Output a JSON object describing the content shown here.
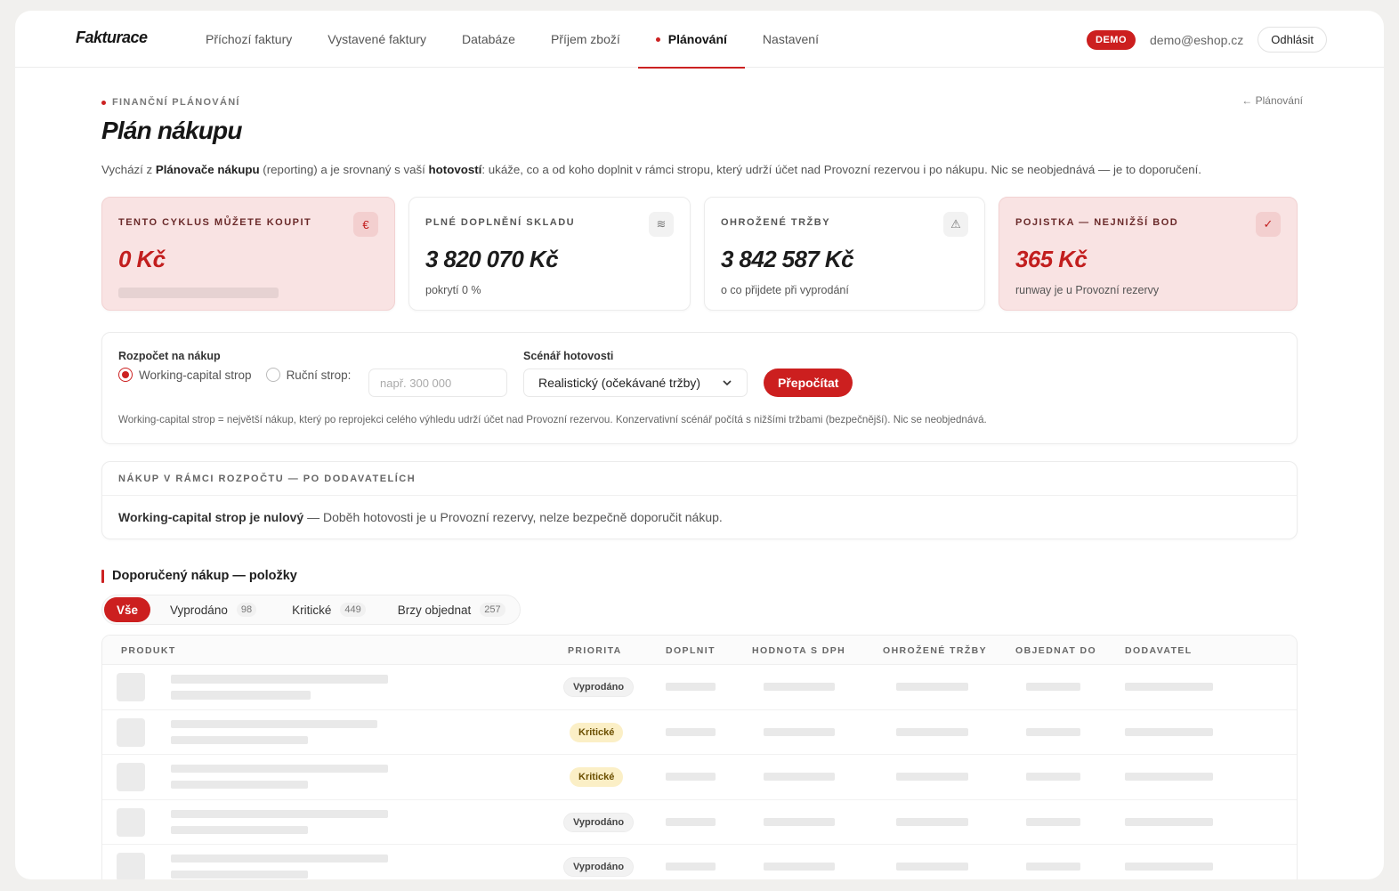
{
  "nav": {
    "brand": "Fakturace",
    "links": [
      "Příchozí faktury",
      "Vystavené faktury",
      "Databáze",
      "Příjem zboží",
      "Plánování",
      "Nastavení"
    ],
    "active_index": 4,
    "demo_badge": "DEMO",
    "email": "demo@eshop.cz",
    "logout": "Odhlásit"
  },
  "header": {
    "eyebrow": "FINANČNÍ PLÁNOVÁNÍ",
    "back_link": "← Plánování",
    "title": "Plán nákupu",
    "intro": {
      "p1": "Vychází z ",
      "b1": "Plánovače nákupu",
      "p2": " (reporting) a je srovnaný s vaší ",
      "b2": "hotovostí",
      "p3": ": ukáže, co a od koho doplnit v rámci stropu, který udrží účet nad Provozní rezervou i po nákupu. Nic se neobjednává — je to doporučení."
    }
  },
  "kpis": [
    {
      "label": "TENTO CYKLUS MŮŽETE KOUPIT",
      "value": "0 Kč",
      "sub": "",
      "icon": "€",
      "icon_name": "euro-icon"
    },
    {
      "label": "PLNÉ DOPLNĚNÍ SKLADU",
      "value": "3 820 070 Kč",
      "sub": "pokrytí 0 %",
      "icon": "≋",
      "icon_name": "layers-icon"
    },
    {
      "label": "OHROŽENÉ TRŽBY",
      "value": "3 842 587 Kč",
      "sub": "o co přijdete při vyprodání",
      "icon": "⚠",
      "icon_name": "warning-icon"
    },
    {
      "label": "POJISTKA — NEJNIŽŠÍ BOD",
      "value": "365 Kč",
      "sub": "runway je u Provozní rezervy",
      "icon": "✓",
      "icon_name": "check-icon"
    }
  ],
  "budget": {
    "label": "Rozpočet na nákup",
    "option_auto": "Working-capital strop",
    "option_manual": "Ruční strop:",
    "manual_placeholder": "např. 300 000",
    "scenario_label": "Scénář hotovosti",
    "scenario_value": "Realistický (očekávané tržby)",
    "recalc_button": "Přepočítat",
    "help": "Working-capital strop = největší nákup, který po reprojekci celého výhledu udrží účet nad Provozní rezervou. Konzervativní scénář počítá s nižšími tržbami (bezpečnější). Nic se neobjednává."
  },
  "supplier": {
    "heading": "NÁKUP V RÁMCI ROZPOČTU — PO DODAVATELÍCH",
    "msg_bold": "Working-capital strop je nulový",
    "msg_rest": " — Doběh hotovosti je u Provozní rezervy, nelze bezpečně doporučit nákup."
  },
  "items": {
    "title": "Doporučený nákup — položky",
    "filters": [
      {
        "label": "Vše",
        "count": ""
      },
      {
        "label": "Vyprodáno",
        "count": "98"
      },
      {
        "label": "Kritické",
        "count": "449"
      },
      {
        "label": "Brzy objednat",
        "count": "257"
      }
    ],
    "columns": [
      "PRODUKT",
      "PRIORITA",
      "DOPLNIT",
      "HODNOTA S DPH",
      "OHROŽENÉ TRŽBY",
      "OBJEDNAT DO",
      "DODAVATEL"
    ],
    "rows": [
      {
        "priority": "Vyprodáno"
      },
      {
        "priority": "Kritické"
      },
      {
        "priority": "Kritické"
      },
      {
        "priority": "Vyprodáno"
      },
      {
        "priority": "Vyprodáno"
      }
    ]
  }
}
